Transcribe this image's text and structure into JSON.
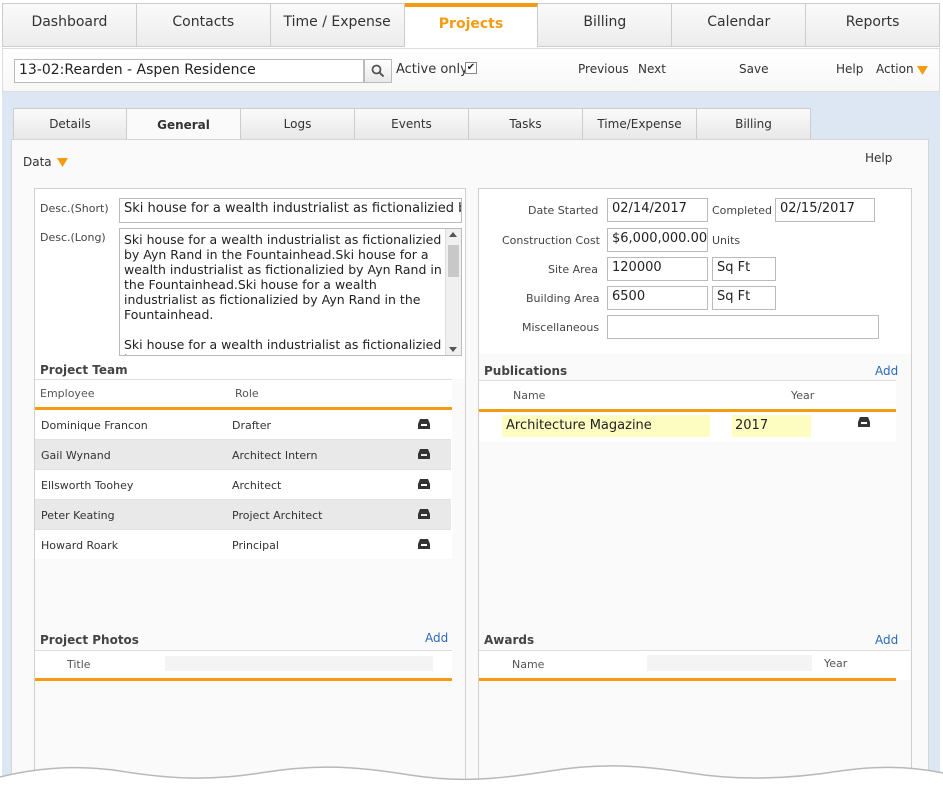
{
  "nav": {
    "tabs": [
      {
        "label": "Dashboard"
      },
      {
        "label": "Contacts"
      },
      {
        "label": "Time / Expense"
      },
      {
        "label": "Projects"
      },
      {
        "label": "Billing"
      },
      {
        "label": "Calendar"
      },
      {
        "label": "Reports"
      }
    ],
    "active": "Projects"
  },
  "toolbar": {
    "project_value": "13-02:Rearden - Aspen Residence",
    "active_only_label": "Active only",
    "active_only_checked": true,
    "previous_label": "Previous",
    "next_label": "Next",
    "save_label": "Save",
    "help_label": "Help",
    "action_label": "Action"
  },
  "subtabs": [
    {
      "label": "Details"
    },
    {
      "label": "General"
    },
    {
      "label": "Logs"
    },
    {
      "label": "Events"
    },
    {
      "label": "Tasks"
    },
    {
      "label": "Time/Expense"
    },
    {
      "label": "Billing"
    }
  ],
  "panel": {
    "data_menu_label": "Data",
    "help_label": "Help"
  },
  "desc": {
    "short_label": "Desc.(Short)",
    "short_value": "Ski house for a wealth industrialist as fictionalizied by Ayn Rand in the Fountainhead.",
    "long_label": "Desc.(Long)",
    "long_value": "Ski house for a wealth industrialist as fictionalizied by Ayn Rand in the Fountainhead.Ski house for a wealth industrialist as fictionalizied by Ayn Rand in the Fountainhead.Ski house for a wealth industrialist as fictionalizied by Ayn Rand in the Fountainhead.\n\nSki house for a wealth industrialist as fictionalizied by"
  },
  "project_info": {
    "date_started_label": "Date Started",
    "date_started": "02/14/2017",
    "completed_label": "Completed",
    "completed": "02/15/2017",
    "construction_cost_label": "Construction Cost",
    "construction_cost": "$6,000,000.00",
    "cost_units_label": "Units",
    "site_area_label": "Site Area",
    "site_area": "120000",
    "site_area_unit": "Sq Ft",
    "building_area_label": "Building Area",
    "building_area": "6500",
    "building_area_unit": "Sq Ft",
    "misc_label": "Miscellaneous",
    "misc_value": ""
  },
  "project_team": {
    "title": "Project Team",
    "col_employee": "Employee",
    "col_role": "Role",
    "rows": [
      {
        "employee": "Dominique Francon",
        "role": "Drafter"
      },
      {
        "employee": "Gail Wynand",
        "role": "Architect Intern"
      },
      {
        "employee": "Ellsworth Toohey",
        "role": "Architect"
      },
      {
        "employee": "Peter Keating",
        "role": "Project Architect"
      },
      {
        "employee": "Howard Roark",
        "role": "Principal"
      }
    ]
  },
  "publications": {
    "title": "Publications",
    "add_label": "Add",
    "col_name": "Name",
    "col_year": "Year",
    "rows": [
      {
        "name": "Architecture Magazine",
        "year": "2017"
      }
    ]
  },
  "photos": {
    "title": "Project Photos",
    "add_label": "Add",
    "col_title": "Title"
  },
  "awards": {
    "title": "Awards",
    "add_label": "Add",
    "col_name": "Name",
    "col_year": "Year"
  },
  "colors": {
    "accent": "#f39c12",
    "link": "#2a6ab8",
    "highlight_field": "#fdfdc2",
    "background_blue": "#dde6f3"
  },
  "icons": {
    "delete_row": "inbox-tray-icon",
    "search": "search-icon",
    "dropdown": "caret-down-icon"
  }
}
